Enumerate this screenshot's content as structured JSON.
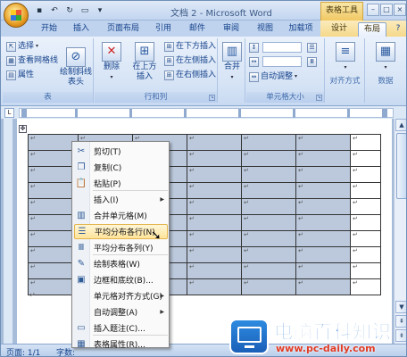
{
  "app": {
    "title": "文档 2 - Microsoft Word",
    "contextual_group": "表格工具"
  },
  "qat": {
    "save_icon": "save-icon",
    "undo_icon": "undo-icon",
    "redo_icon": "redo-icon",
    "open_icon": "open-icon"
  },
  "window_controls": {
    "minimize": "–",
    "maximize": "□",
    "close": "×"
  },
  "tabs": [
    {
      "label": "开始"
    },
    {
      "label": "插入"
    },
    {
      "label": "页面布局"
    },
    {
      "label": "引用"
    },
    {
      "label": "邮件"
    },
    {
      "label": "审阅"
    },
    {
      "label": "视图"
    },
    {
      "label": "加载项"
    },
    {
      "label": "设计"
    },
    {
      "label": "布局"
    }
  ],
  "ribbon": {
    "table_group": {
      "label": "表",
      "select": "选择",
      "view_gridlines": "查看网格线",
      "properties": "属性",
      "draw_diagonal": "绘制斜线表头"
    },
    "rows_cols_group": {
      "label": "行和列",
      "delete": "删除",
      "insert_above": "在上方插入",
      "insert_below": "在下方插入",
      "insert_left": "在左侧插入",
      "insert_right": "在右侧插入"
    },
    "merge_group": {
      "merge": "合并"
    },
    "cell_size_group": {
      "label": "单元格大小",
      "autofit": "自动调整"
    },
    "alignment_group": {
      "label": "对齐方式"
    },
    "data_group": {
      "label": "数据"
    }
  },
  "document": {
    "cell_mark": "↵",
    "after_table_mark": "↵"
  },
  "context_menu": {
    "items": [
      {
        "label": "剪切(T)",
        "icon": "scissors-icon"
      },
      {
        "label": "复制(C)",
        "icon": "copy-icon"
      },
      {
        "label": "粘贴(P)",
        "icon": "paste-icon"
      },
      {
        "label": "插入(I)",
        "icon": "",
        "submenu": true
      },
      {
        "label": "合并单元格(M)",
        "icon": "merge-cells-icon"
      },
      {
        "label": "平均分布各行(N)",
        "icon": "distribute-rows-icon",
        "highlighted": true
      },
      {
        "label": "平均分布各列(Y)",
        "icon": "distribute-columns-icon"
      },
      {
        "label": "绘制表格(W)",
        "icon": "draw-table-icon"
      },
      {
        "label": "边框和底纹(B)...",
        "icon": "borders-icon"
      },
      {
        "label": "单元格对齐方式(G)",
        "icon": "",
        "submenu": true
      },
      {
        "label": "自动调整(A)",
        "icon": "",
        "submenu": true
      },
      {
        "label": "插入题注(C)...",
        "icon": "caption-icon"
      },
      {
        "label": "表格属性(R)...",
        "icon": "table-properties-icon"
      }
    ]
  },
  "status": {
    "page": "页面: 1/1",
    "words": "字数:"
  },
  "watermark": {
    "title": "电脑百科知识",
    "url": "www.pc-daily.com"
  }
}
